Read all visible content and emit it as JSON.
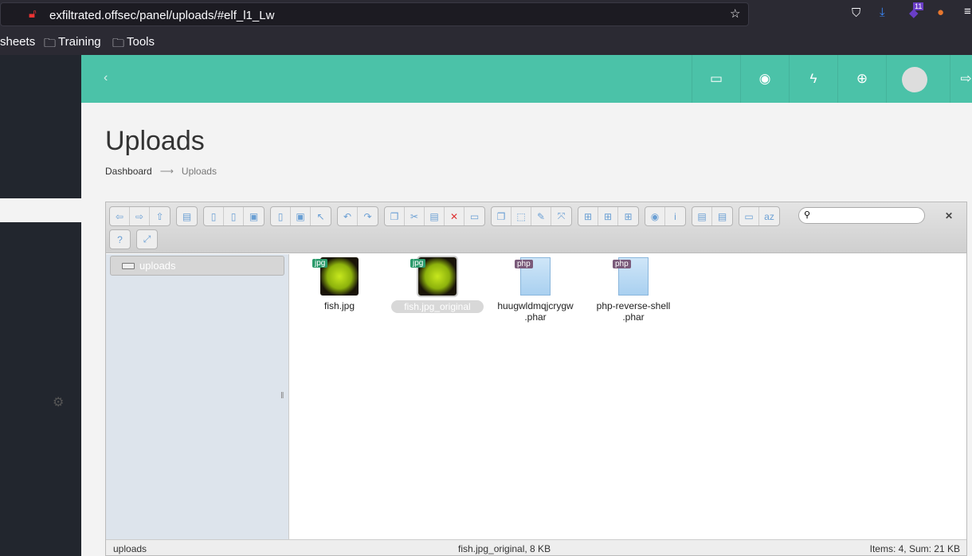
{
  "browser": {
    "url": "exfiltrated.offsec/panel/uploads/#elf_l1_Lw",
    "badge_count": "11",
    "bookmarks": [
      "sheets",
      "Training",
      "Tools"
    ]
  },
  "topbar": {
    "items": [
      "monitor-icon",
      "eye-icon",
      "bolt-icon",
      "lifebuoy-icon",
      "avatar",
      "logout-icon"
    ]
  },
  "page": {
    "title": "Uploads",
    "breadcrumb": [
      "Dashboard",
      "Uploads"
    ]
  },
  "toolbar": {
    "groups": [
      [
        "back",
        "forward",
        "up"
      ],
      [
        "netmount"
      ],
      [
        "mkdir",
        "mkfile",
        "upload"
      ],
      [
        "open",
        "download",
        "getfile"
      ],
      [
        "undo",
        "redo"
      ],
      [
        "copy",
        "cut",
        "paste",
        "rm",
        "empty"
      ],
      [
        "duplicate",
        "rename",
        "edit",
        "resize"
      ],
      [
        "icons-view",
        "list-view",
        "view"
      ],
      [
        "quicklook",
        "info"
      ],
      [
        "extract",
        "archive"
      ],
      [
        "sort",
        "sort-az"
      ],
      [
        "help"
      ],
      [
        "fullscreen"
      ]
    ],
    "search_placeholder": ""
  },
  "tree": {
    "root": "uploads"
  },
  "files": [
    {
      "name": "fish.jpg",
      "line2": "",
      "type": "jpg",
      "selected": false
    },
    {
      "name": "fish.jpg_original",
      "line2": "",
      "type": "jpg",
      "selected": true
    },
    {
      "name": "huugwldmqjcrygw",
      ".line2": "",
      "line2": ".phar",
      "type": "php",
      "selected": false
    },
    {
      "name": "php-reverse-shell",
      "line2": ".phar",
      "type": "php",
      "selected": false
    }
  ],
  "status": {
    "left": "uploads",
    "center": "fish.jpg_original, 8 KB",
    "right": "Items: 4, Sum: 21 KB"
  }
}
